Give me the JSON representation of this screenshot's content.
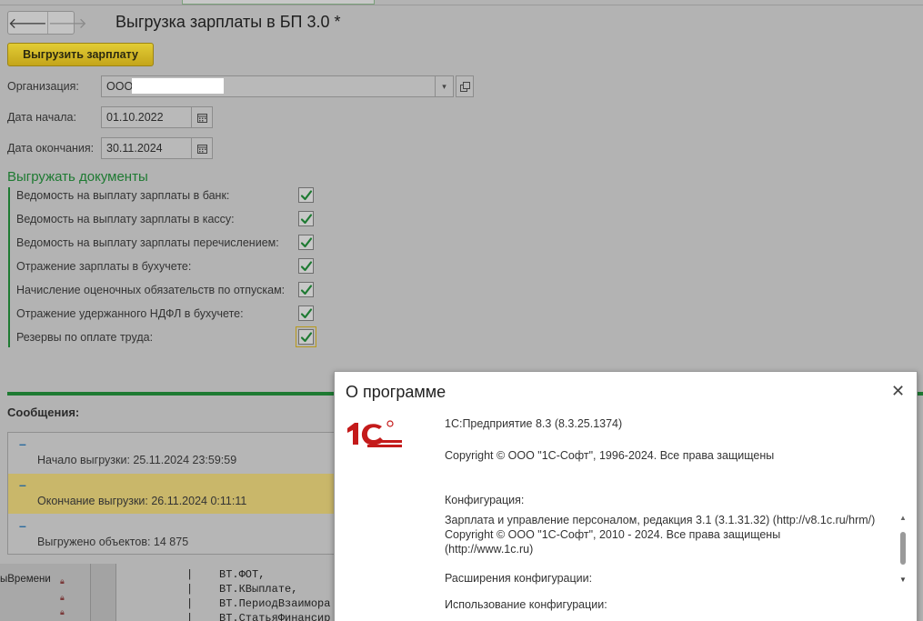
{
  "nav": {
    "back_icon": "arrow-left-icon",
    "forward_icon": "arrow-right-icon",
    "back_glyph": "🡐",
    "forward_glyph": "🡒"
  },
  "form": {
    "title": "Выгрузка зарплаты в БП 3.0 *",
    "export_button": "Выгрузить зарплату",
    "organization_label": "Организация:",
    "organization_value": "ООО",
    "start_date_label": "Дата начала:",
    "start_date_value": "01.10.2022",
    "end_date_label": "Дата окончания:",
    "end_date_value": "30.11.2024"
  },
  "documents": {
    "title": "Выгружать документы",
    "items": [
      {
        "label": "Ведомость на выплату зарплаты в банк:",
        "checked": true
      },
      {
        "label": "Ведомость на выплату зарплаты в кассу:",
        "checked": true
      },
      {
        "label": "Ведомость на выплату зарплаты перечислением:",
        "checked": true
      },
      {
        "label": "Отражение зарплаты в бухучете:",
        "checked": true
      },
      {
        "label": "Начисление оценочных обязательств по отпускам:",
        "checked": true
      },
      {
        "label": "Отражение удержанного НДФЛ в бухучете:",
        "checked": true
      },
      {
        "label": "Резервы по оплате труда:",
        "checked": true
      }
    ]
  },
  "messages": {
    "title": "Сообщения:",
    "marker": "–",
    "items": [
      {
        "text": "Начало выгрузки: 25.11.2024 23:59:59",
        "highlighted": false
      },
      {
        "text": "Окончание выгрузки: 26.11.2024 0:11:11",
        "highlighted": true
      },
      {
        "text": "Выгружено объектов: 14 875",
        "highlighted": false
      }
    ]
  },
  "background_code": {
    "left_label": "ыВремени",
    "lines": [
      "|    ВТ.ФОТ,",
      "|    ВТ.КВыплате,",
      "|    ВТ.ПериодВзаимора",
      "|    ВТ.СтатьяФинансир"
    ]
  },
  "about": {
    "title": "О программе",
    "close_glyph": "✕",
    "platform": "1С:Предприятие 8.3 (8.3.25.1374)",
    "copyright": "Copyright © ООО \"1С-Софт\", 1996-2024. Все права защищены",
    "config_label": "Конфигурация:",
    "config_line1": "Зарплата и управление персоналом, редакция 3.1 (3.1.31.32) (http://v8.1c.ru/hrm/)",
    "config_line2": "Copyright © ООО \"1С-Софт\", 2010 - 2024. Все права защищены",
    "config_line3": "(http://www.1c.ru)",
    "extensions_label": "Расширения конфигурации:",
    "usage_label": "Использование конфигурации:",
    "logo_text": "1С",
    "colors": {
      "logo_red": "#c41a1a",
      "accent_green": "#1e7a32",
      "highlight": "#c9b76a"
    }
  }
}
